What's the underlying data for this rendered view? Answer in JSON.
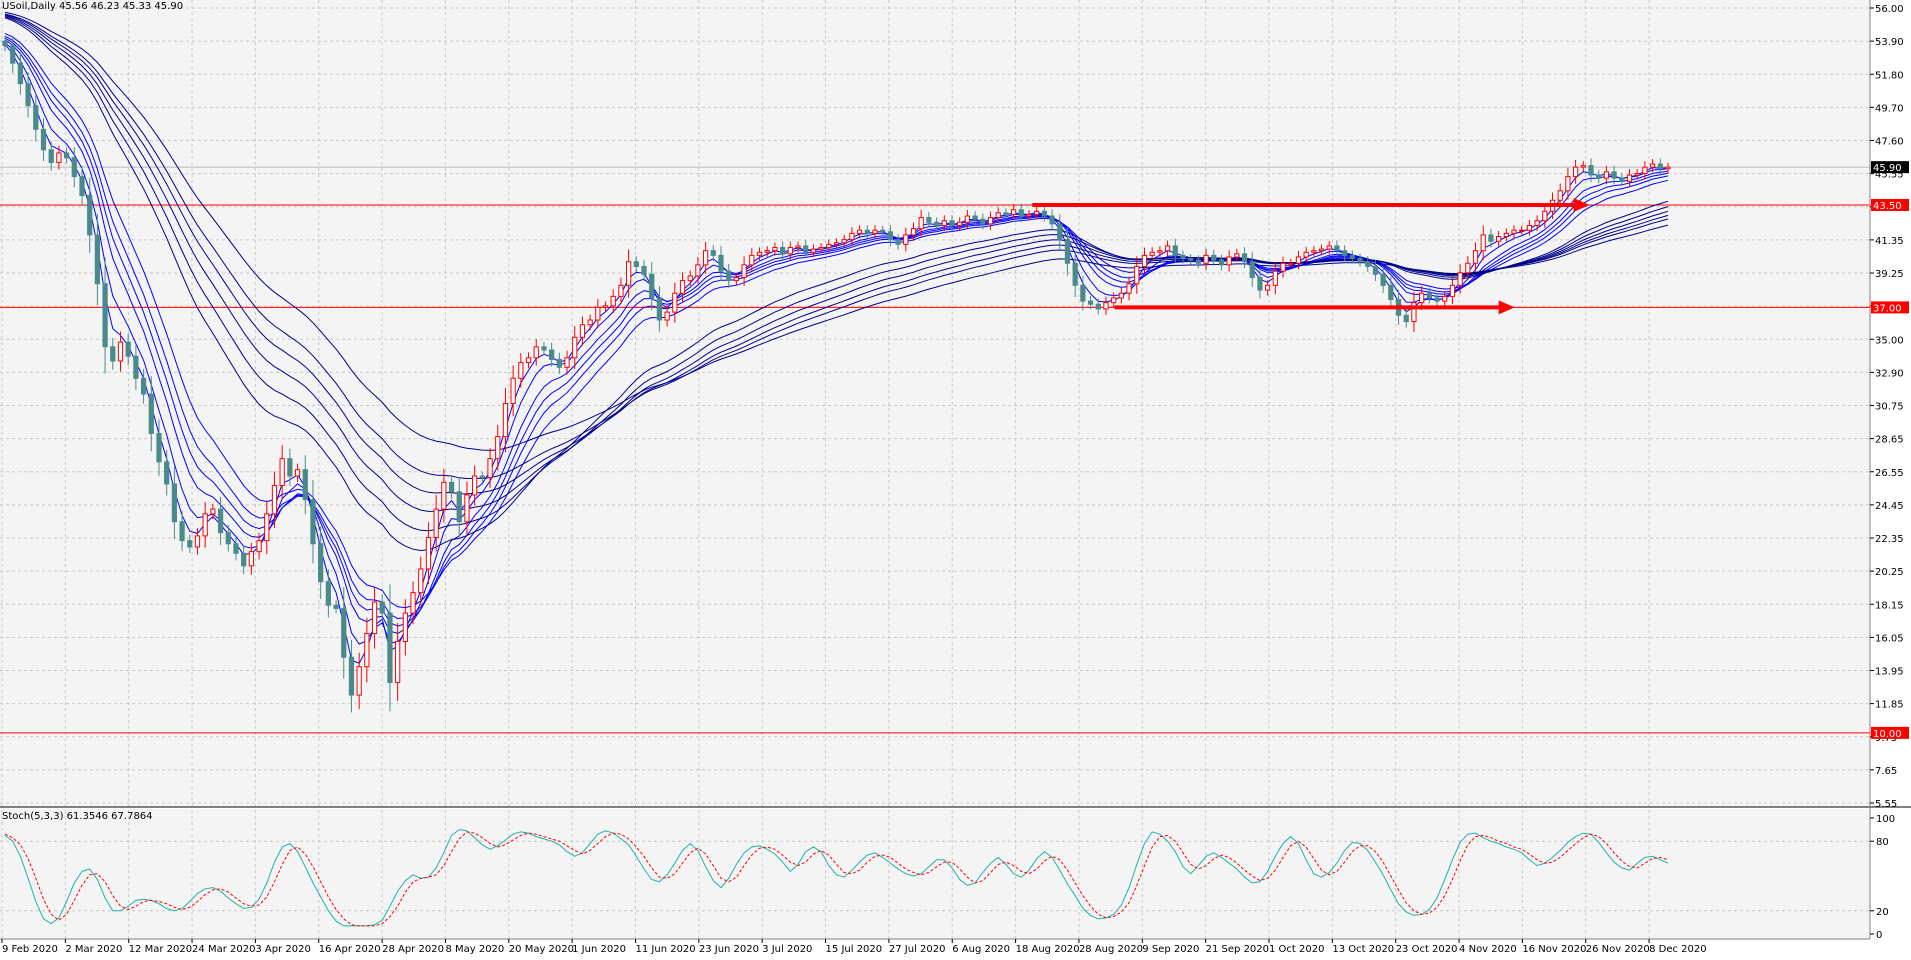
{
  "chart_data": {
    "type": "candlestick",
    "symbol_header": "USoil,Daily  45.56 46.23 45.33 45.90",
    "x_ticks": [
      "9 Feb 2020",
      "2 Mar 2020",
      "12 Mar 2020",
      "24 Mar 2020",
      "3 Apr 2020",
      "16 Apr 2020",
      "28 Apr 2020",
      "8 May 2020",
      "20 May 2020",
      "1 Jun 2020",
      "11 Jun 2020",
      "23 Jun 2020",
      "3 Jul 2020",
      "15 Jul 2020",
      "27 Jul 2020",
      "6 Aug 2020",
      "18 Aug 2020",
      "28 Aug 2020",
      "9 Sep 2020",
      "21 Sep 2020",
      "1 Oct 2020",
      "13 Oct 2020",
      "23 Oct 2020",
      "4 Nov 2020",
      "16 Nov 2020",
      "26 Nov 2020",
      "8 Dec 2020"
    ],
    "y_ticks": [
      "56.00",
      "53.90",
      "51.80",
      "49.70",
      "47.60",
      "45.55",
      "43.50",
      "41.35",
      "39.25",
      "37.15",
      "35.00",
      "32.90",
      "30.75",
      "28.65",
      "26.55",
      "24.45",
      "22.35",
      "20.25",
      "18.15",
      "16.05",
      "13.95",
      "11.85",
      "9.75",
      "7.65",
      "5.55"
    ],
    "y_range": [
      5.55,
      56.0
    ],
    "close_series": [
      53.6,
      52.5,
      51.2,
      49.8,
      48.3,
      47.0,
      46.2,
      46.8,
      46.5,
      45.3,
      44.1,
      41.6,
      38.5,
      34.5,
      33.6,
      34.8,
      33.9,
      32.5,
      31.5,
      29.0,
      27.2,
      25.8,
      23.4,
      22.2,
      21.8,
      22.5,
      23.9,
      24.2,
      22.7,
      22.0,
      21.4,
      20.6,
      21.5,
      22.2,
      23.9,
      25.7,
      27.4,
      26.3,
      26.7,
      24.8,
      22.0,
      19.6,
      18.1,
      17.9,
      14.8,
      12.4,
      14.2,
      16.3,
      18.3,
      17.6,
      13.2,
      15.8,
      17.6,
      18.9,
      20.4,
      22.4,
      24.2,
      25.9,
      25.3,
      23.4,
      25.1,
      26.3,
      26.2,
      27.4,
      28.8,
      30.9,
      32.5,
      33.5,
      33.8,
      34.5,
      34.3,
      33.7,
      33.2,
      33.8,
      35.1,
      35.9,
      36.2,
      37.0,
      37.1,
      37.7,
      38.4,
      39.9,
      39.6,
      39.1,
      37.6,
      36.2,
      36.7,
      37.9,
      38.7,
      39.0,
      39.7,
      40.6,
      40.3,
      39.3,
      38.7,
      38.9,
      39.7,
      40.3,
      40.5,
      40.6,
      40.8,
      40.4,
      40.8,
      40.9,
      40.5,
      40.7,
      40.8,
      41.0,
      41.1,
      41.3,
      41.7,
      41.9,
      41.7,
      41.9,
      41.8,
      41.3,
      41.0,
      41.6,
      42.0,
      42.7,
      42.4,
      42.2,
      42.5,
      42.2,
      42.4,
      42.8,
      42.6,
      42.3,
      42.7,
      43.0,
      42.9,
      43.2,
      42.8,
      42.9,
      43.1,
      42.8,
      42.3,
      41.3,
      39.8,
      38.4,
      37.4,
      37.2,
      36.9,
      37.3,
      37.6,
      37.9,
      38.5,
      39.6,
      40.3,
      40.5,
      40.6,
      40.9,
      40.3,
      40.1,
      40.0,
      39.8,
      40.3,
      40.0,
      39.7,
      40.2,
      40.4,
      39.9,
      38.9,
      38.1,
      38.4,
      39.3,
      39.8,
      39.8,
      40.2,
      40.5,
      40.6,
      40.7,
      40.9,
      40.6,
      40.3,
      40.1,
      39.9,
      39.6,
      39.1,
      38.4,
      37.5,
      36.5,
      36.1,
      37.3,
      37.9,
      37.6,
      37.4,
      37.7,
      38.4,
      39.2,
      39.8,
      40.6,
      41.6,
      41.2,
      41.5,
      41.7,
      41.9,
      41.9,
      42.2,
      42.5,
      43.1,
      43.8,
      44.4,
      45.3,
      45.9,
      46.0,
      45.4,
      45.2,
      45.6,
      45.2,
      45.0,
      45.4,
      45.5,
      45.9,
      46.1,
      45.8,
      45.9
    ],
    "stoch": {
      "label": "Stoch(5,3,3) 61.3546 67.7864",
      "k_color": "#20b2aa",
      "d_color": "#ff0000",
      "y_ticks": [
        "100",
        "80",
        "20",
        "0"
      ],
      "k_series": [
        85,
        80,
        67,
        48,
        28,
        13,
        9,
        14,
        28,
        44,
        54,
        56,
        47,
        31,
        20,
        20,
        24,
        29,
        30,
        29,
        26,
        22,
        20,
        22,
        28,
        35,
        39,
        40,
        37,
        31,
        26,
        22,
        23,
        30,
        44,
        62,
        75,
        78,
        71,
        58,
        44,
        32,
        20,
        11,
        7,
        7,
        7,
        7,
        8,
        12,
        24,
        37,
        46,
        51,
        48,
        49,
        57,
        70,
        85,
        90,
        89,
        83,
        77,
        73,
        76,
        81,
        86,
        88,
        87,
        84,
        82,
        80,
        77,
        71,
        67,
        70,
        78,
        86,
        89,
        87,
        82,
        77,
        67,
        56,
        47,
        45,
        51,
        61,
        72,
        78,
        72,
        58,
        46,
        40,
        48,
        60,
        70,
        75,
        76,
        73,
        69,
        62,
        54,
        60,
        71,
        75,
        71,
        59,
        51,
        49,
        55,
        62,
        68,
        70,
        66,
        61,
        56,
        52,
        50,
        52,
        58,
        64,
        64,
        57,
        47,
        42,
        44,
        53,
        61,
        66,
        60,
        52,
        49,
        55,
        65,
        71,
        66,
        55,
        43,
        33,
        22,
        16,
        13,
        14,
        17,
        25,
        40,
        60,
        78,
        88,
        86,
        80,
        71,
        58,
        52,
        59,
        67,
        70,
        66,
        61,
        56,
        49,
        44,
        45,
        54,
        67,
        78,
        84,
        78,
        64,
        52,
        49,
        53,
        61,
        72,
        79,
        78,
        72,
        62,
        51,
        38,
        26,
        19,
        16,
        17,
        21,
        31,
        47,
        64,
        79,
        86,
        87,
        83,
        80,
        78,
        75,
        73,
        70,
        64,
        59,
        61,
        66,
        72,
        79,
        84,
        87,
        86,
        79,
        70,
        62,
        57,
        55,
        61,
        66,
        67,
        64,
        61
      ],
      "d_series": [
        86,
        83,
        77,
        65,
        48,
        30,
        17,
        12,
        17,
        29,
        42,
        51,
        52,
        45,
        33,
        24,
        21,
        24,
        28,
        29,
        28,
        26,
        23,
        21,
        23,
        28,
        34,
        38,
        39,
        36,
        31,
        26,
        24,
        25,
        32,
        45,
        60,
        72,
        75,
        69,
        58,
        45,
        32,
        21,
        13,
        8,
        7,
        7,
        7,
        9,
        15,
        24,
        36,
        45,
        48,
        49,
        51,
        59,
        71,
        82,
        88,
        87,
        83,
        78,
        75,
        77,
        81,
        85,
        87,
        86,
        84,
        82,
        80,
        76,
        72,
        69,
        72,
        78,
        84,
        87,
        86,
        82,
        75,
        67,
        57,
        49,
        48,
        52,
        61,
        70,
        74,
        69,
        59,
        48,
        45,
        49,
        59,
        68,
        74,
        75,
        73,
        68,
        62,
        59,
        62,
        69,
        72,
        68,
        60,
        53,
        52,
        55,
        62,
        67,
        68,
        66,
        61,
        56,
        53,
        51,
        53,
        58,
        62,
        62,
        56,
        49,
        44,
        46,
        53,
        60,
        62,
        59,
        54,
        52,
        56,
        63,
        67,
        64,
        55,
        44,
        33,
        24,
        17,
        14,
        15,
        19,
        27,
        42,
        59,
        75,
        84,
        85,
        80,
        70,
        60,
        56,
        59,
        65,
        68,
        66,
        61,
        55,
        50,
        46,
        48,
        55,
        66,
        76,
        80,
        75,
        65,
        55,
        51,
        54,
        62,
        71,
        76,
        76,
        71,
        62,
        50,
        38,
        27,
        20,
        17,
        18,
        23,
        33,
        47,
        63,
        77,
        84,
        85,
        83,
        80,
        78,
        75,
        73,
        69,
        64,
        61,
        62,
        66,
        72,
        78,
        83,
        86,
        84,
        78,
        70,
        63,
        58,
        57,
        61,
        65,
        66,
        64
      ]
    },
    "horizontal_levels": [
      {
        "value": 43.5,
        "label": "43.50",
        "color": "#ff0000"
      },
      {
        "value": 37.0,
        "label": "37.00",
        "color": "#ff0000"
      },
      {
        "value": 10.0,
        "label": "10.00",
        "color": "#ff0000"
      }
    ],
    "current_price": {
      "value": 45.9,
      "label": "45.90"
    },
    "arrows": [
      {
        "from": [
          0.552,
          43.5
        ],
        "to": [
          0.85,
          43.5
        ],
        "color": "#ff0000"
      },
      {
        "from": [
          0.596,
          37.0
        ],
        "to": [
          0.81,
          37.0
        ],
        "color": "#ff0000"
      }
    ],
    "ma_periods": [
      3,
      5,
      8,
      10,
      12,
      15,
      30,
      35,
      40,
      45,
      50,
      60
    ],
    "colors": {
      "bull": "#ff0000",
      "bear": "#4a8a8a",
      "ma_fast": "#0000ff",
      "ma_slow": "#00008b",
      "grid": "#c8c8c8",
      "background": "#f4f4f4"
    }
  }
}
